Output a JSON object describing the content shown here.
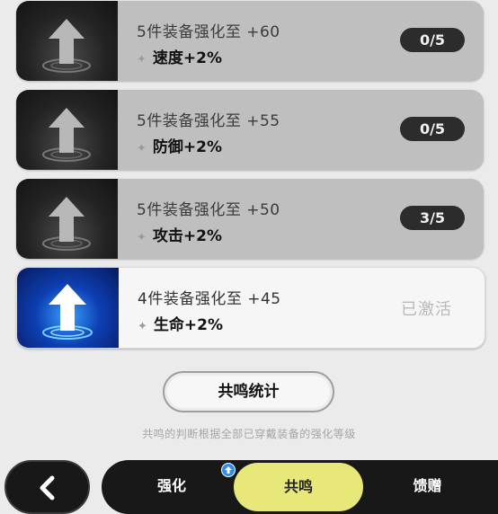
{
  "bonuses": [
    {
      "title": "5件装备强化至 +60",
      "effect": "速度+2%",
      "progress": "0/5",
      "state": "locked"
    },
    {
      "title": "5件装备强化至 +55",
      "effect": "防御+2%",
      "progress": "0/5",
      "state": "locked"
    },
    {
      "title": "5件装备强化至 +50",
      "effect": "攻击+2%",
      "progress": "3/5",
      "state": "locked"
    },
    {
      "title": "4件装备强化至 +45",
      "effect": "生命+2%",
      "progress": "已激活",
      "state": "active"
    }
  ],
  "stats_button": "共鸣统计",
  "hint": "共鸣的判断根据全部已穿戴装备的强化等级",
  "nav": {
    "back_icon": "chevron-left-icon",
    "tabs": [
      {
        "label": "强化",
        "active": false
      },
      {
        "label": "共鸣",
        "active": true
      },
      {
        "label": "馈赠",
        "active": false
      }
    ]
  },
  "colors": {
    "active_tab": "#e8e87a",
    "active_card_glow": "#1e7bff",
    "badge": "#2b8ef0"
  }
}
